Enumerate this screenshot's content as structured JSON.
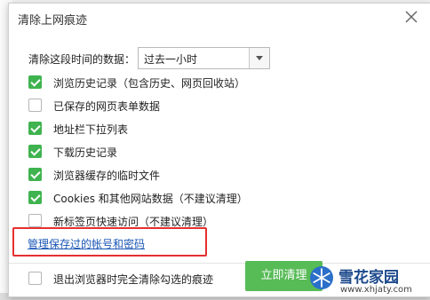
{
  "dialog": {
    "title": "清除上网痕迹",
    "close_icon": "close-icon"
  },
  "time_range": {
    "label": "清除这段时间的数据：",
    "selected": "过去一小时"
  },
  "options": [
    {
      "label": "浏览历史记录（包含历史、网页回收站）",
      "checked": true
    },
    {
      "label": "已保存的网页表单数据",
      "checked": false
    },
    {
      "label": "地址栏下拉列表",
      "checked": true
    },
    {
      "label": "下载历史记录",
      "checked": true
    },
    {
      "label": "浏览器缓存的临时文件",
      "checked": true
    },
    {
      "label": "Cookies 和其他网站数据（不建议清理）",
      "checked": true
    },
    {
      "label": "新标签页快速访问（不建议清理）",
      "checked": false
    }
  ],
  "manage_link": "管理保存过的帐号和密码",
  "footer": {
    "exit_clear_label": "退出浏览器时完全清除勾选的痕迹",
    "exit_clear_checked": false,
    "clear_button": "立即清理"
  },
  "watermark": {
    "name": "雪花家园",
    "url": "www.xhjaty.com"
  },
  "colors": {
    "checkbox_on": "#3fb34f",
    "button": "#57bb56",
    "link": "#1a56b5",
    "highlight": "#e53030"
  }
}
